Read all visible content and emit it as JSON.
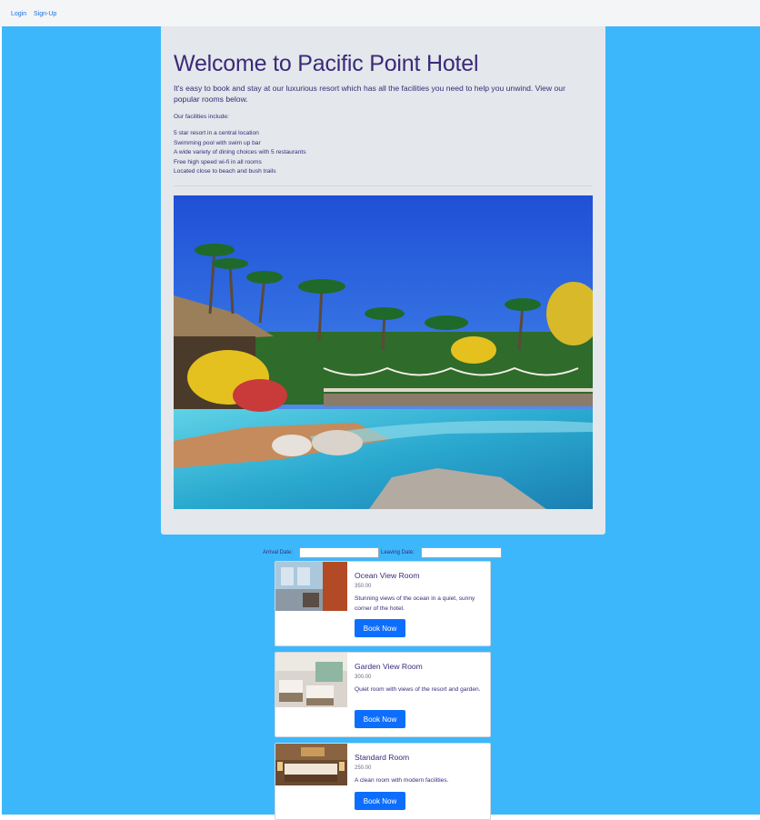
{
  "nav": {
    "login": "Login",
    "signup": "Sign-Up"
  },
  "hero": {
    "title": "Welcome to Pacific Point Hotel",
    "lead": "It's easy to book and stay at our luxurious resort which has all the facilities you need to help you unwind. View our popular rooms below.",
    "facilities_title": "Our facilities include:",
    "facilities": [
      "5 star resort in a central location",
      "Swimming pool with swim up bar",
      "A wide variety of dining choices with 5 restaurants",
      "Free high speed wi-fi in all rooms",
      "Located close to beach and bush trails"
    ]
  },
  "booking": {
    "arrival_label": "Arrival Date:",
    "leaving_label": "Leaving Date:",
    "arrival_value": "",
    "leaving_value": ""
  },
  "rooms": [
    {
      "name": "Ocean View Room",
      "price": "350.00",
      "description": "Stunning views of the ocean in a quiet, sunny corner of the hotel.",
      "button": "Book Now"
    },
    {
      "name": "Garden View Room",
      "price": "300.00",
      "description": "Quiet room with views of the resort and garden.",
      "button": "Book Now"
    },
    {
      "name": "Standard Room",
      "price": "250.00",
      "description": "A clean room with modern facilities.",
      "button": "Book Now"
    }
  ],
  "colors": {
    "page_bg": "#3db7fb",
    "jumbotron_bg": "#e4e7eb",
    "primary_button": "#0d6efd",
    "heading_text": "#3a2a7a"
  }
}
